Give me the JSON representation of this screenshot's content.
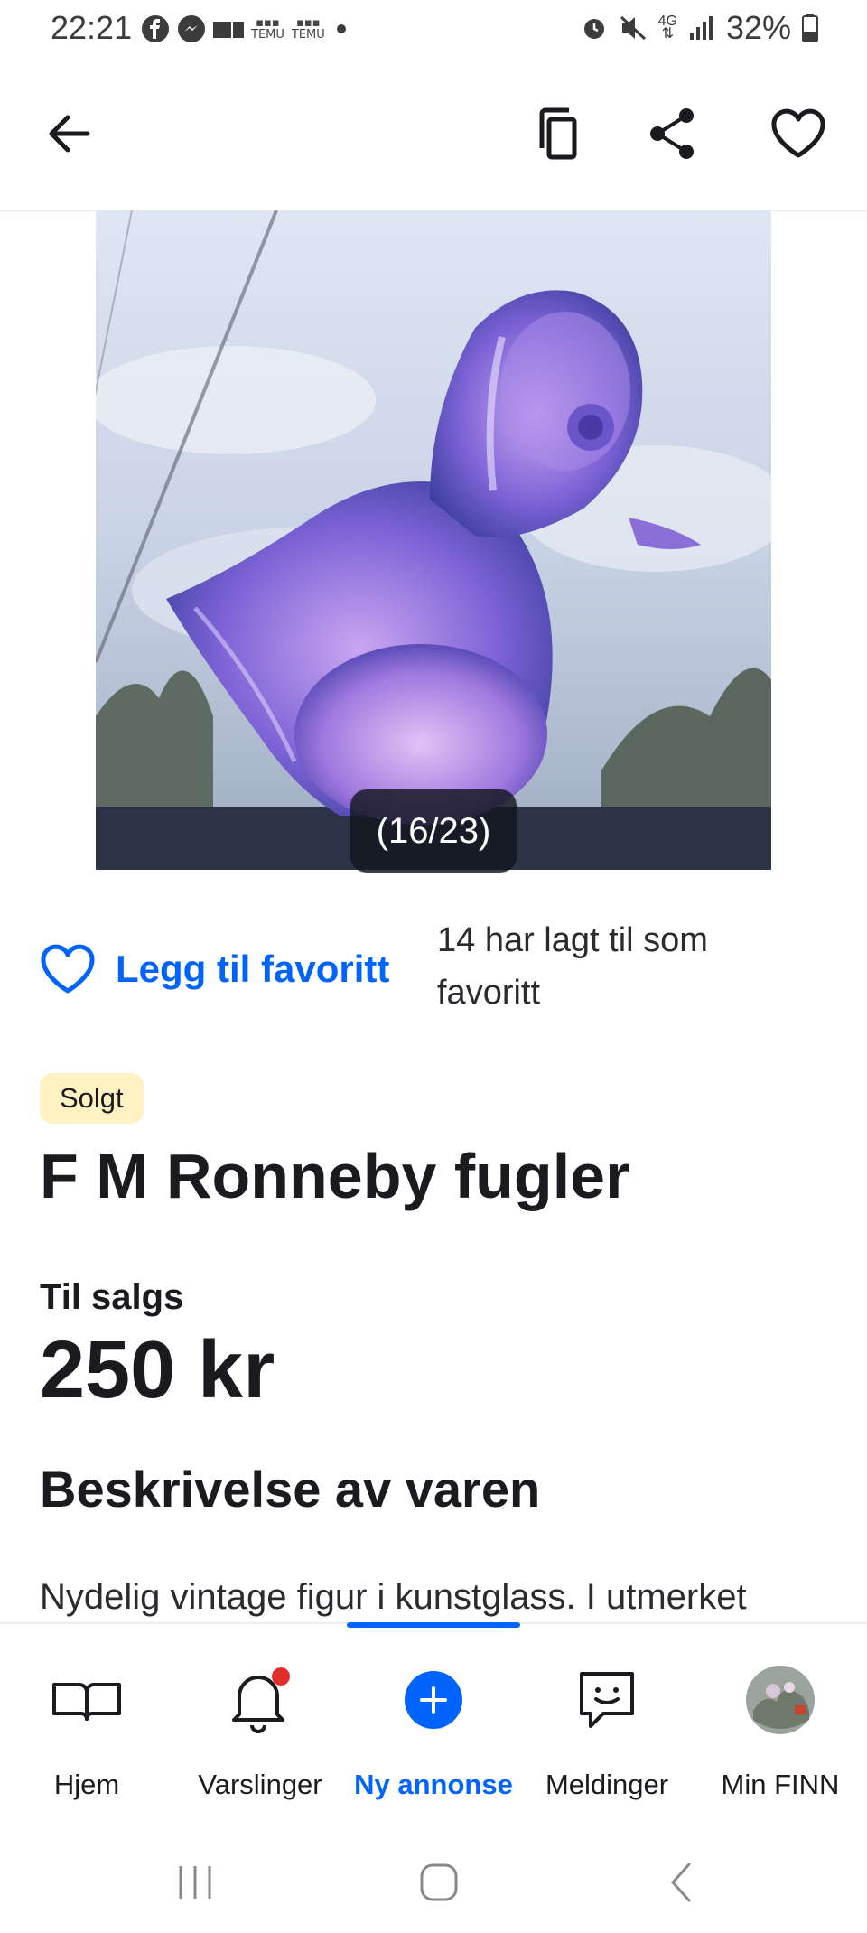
{
  "status_bar": {
    "time": "22:21",
    "notif_text_1": "TEMU",
    "notif_text_2": "TEMU",
    "network": "4G",
    "battery": "32%"
  },
  "app_bar": {
    "icons": [
      "back-arrow-icon",
      "copy-icon",
      "share-icon",
      "heart-icon"
    ]
  },
  "gallery": {
    "counter": "(16/23)"
  },
  "favorite": {
    "label": "Legg til favoritt",
    "count_text": "14 har lagt til som favoritt"
  },
  "listing": {
    "status_badge": "Solgt",
    "title": "F M Ronneby fugler",
    "sale_type": "Til salgs",
    "price": "250 kr",
    "description_heading": "Beskrivelse av varen",
    "description": "Nydelig vintage figur i kunstglass. I utmerket"
  },
  "bottom_nav": {
    "items": [
      {
        "label": "Hjem",
        "icon": "book-icon"
      },
      {
        "label": "Varslinger",
        "icon": "bell-icon"
      },
      {
        "label": "Ny annonse",
        "icon": "plus-circle-icon",
        "active": true
      },
      {
        "label": "Meldinger",
        "icon": "chat-icon"
      },
      {
        "label": "Min FINN",
        "icon": "avatar"
      }
    ]
  },
  "colors": {
    "accent": "#0063fb",
    "badge_bg": "#fff2c2",
    "notification_dot": "#e32d2d"
  }
}
